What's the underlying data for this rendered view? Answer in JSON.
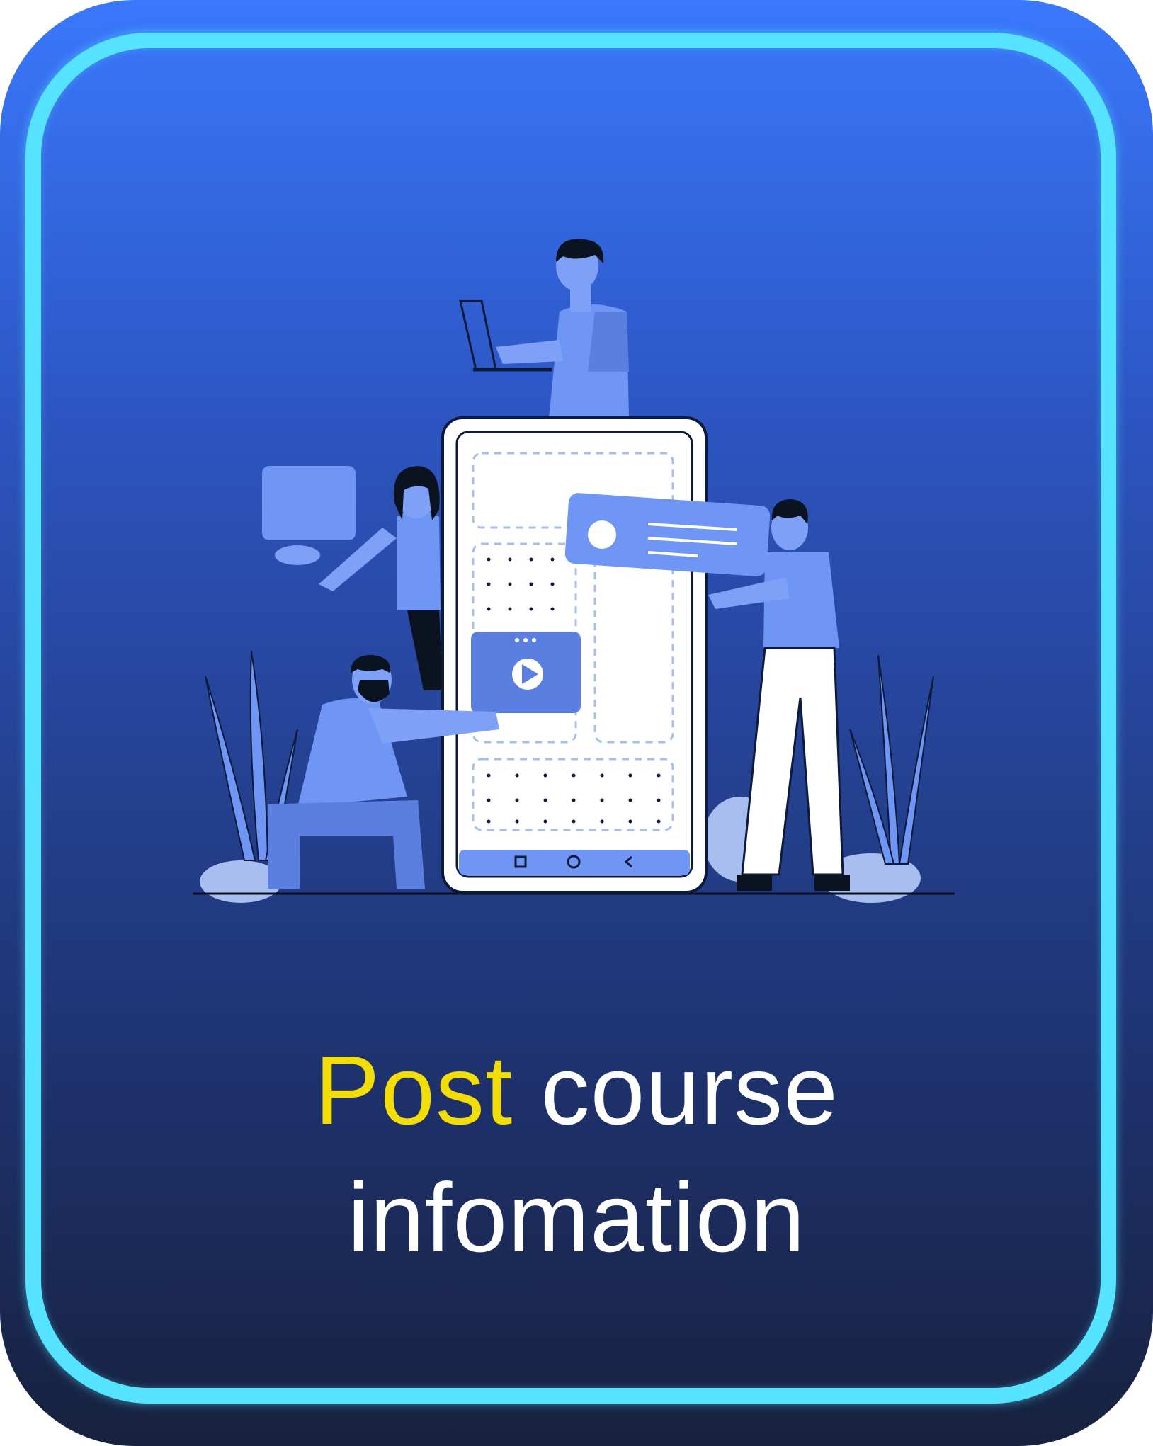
{
  "card": {
    "title_accent": "Post",
    "title_rest": "course",
    "title_line2": "infomation"
  },
  "illustration": {
    "icon": "team-building-mobile-app-illustration"
  },
  "colors": {
    "gradient_top": "#3a78fc",
    "gradient_bottom": "#17223e",
    "ring": "#55e3ff",
    "accent_text": "#f2dd05",
    "text": "#ffffff",
    "figure_blue": "#6f95f5",
    "figure_dark_blue": "#5a7fe0"
  }
}
